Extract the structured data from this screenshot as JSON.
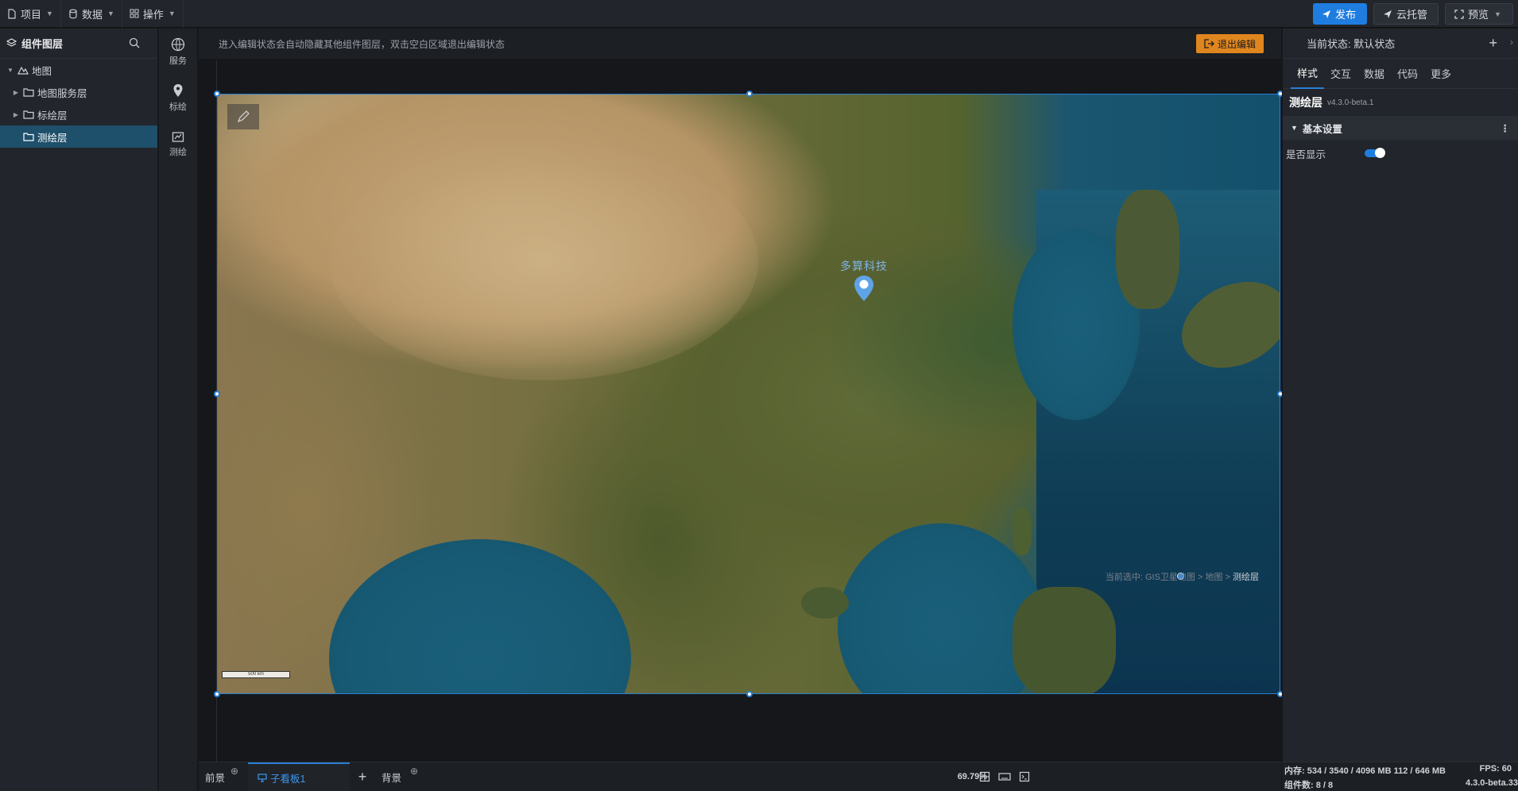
{
  "topbar": {
    "menus": [
      {
        "label": "项目",
        "icon": "file-icon"
      },
      {
        "label": "数据",
        "icon": "database-icon"
      },
      {
        "label": "操作",
        "icon": "grid-icon"
      }
    ],
    "publish_label": "发布",
    "cloud_label": "云托管",
    "preview_label": "预览"
  },
  "layers": {
    "title": "组件图层",
    "items": [
      {
        "label": "地图",
        "icon": "map-icon",
        "expanded": true
      },
      {
        "label": "地图服务层",
        "icon": "folder-icon"
      },
      {
        "label": "标绘层",
        "icon": "folder-icon"
      },
      {
        "label": "测绘层",
        "icon": "folder-icon",
        "selected": true
      }
    ]
  },
  "strip": {
    "items": [
      {
        "label": "服务",
        "icon": "globe-icon"
      },
      {
        "label": "标绘",
        "icon": "location-pin-icon"
      },
      {
        "label": "测绘",
        "icon": "survey-icon"
      }
    ]
  },
  "canvas": {
    "hint": "进入编辑状态会自动隐藏其他组件图层，双击空白区域退出编辑状态",
    "exit_edit_label": "退出编辑",
    "pin_label": "多算科技",
    "scale_label": "500 km",
    "selected_path_prefix": "当前选中: GIS卫星地图 > 地图 >",
    "selected_path_current": "测绘层"
  },
  "bottombar": {
    "tabs": [
      {
        "label": "前景",
        "active": false
      },
      {
        "label": "子看板1",
        "active": true
      },
      {
        "label": "背景",
        "active": false
      }
    ],
    "add_label": "+",
    "zoom": "69.79%"
  },
  "props": {
    "state_label": "当前状态:  默认状态",
    "tabs": [
      "样式",
      "交互",
      "数据",
      "代码",
      "更多"
    ],
    "active_tab": "样式",
    "component_name": "测绘层",
    "component_version": "v4.3.0-beta.1",
    "section_title": "基本设置",
    "show_label": "是否显示",
    "show_value": true
  },
  "status": {
    "memory": "内存:  534 / 3540 / 4096 MB  112 / 646 MB",
    "fps": "FPS:  60",
    "component_count": "组件数: 8 / 8",
    "version": "4.3.0-beta.33"
  },
  "colors": {
    "accent": "#1f7de0",
    "selected_row": "#1e4f6b",
    "exit_button": "#e0861e"
  }
}
